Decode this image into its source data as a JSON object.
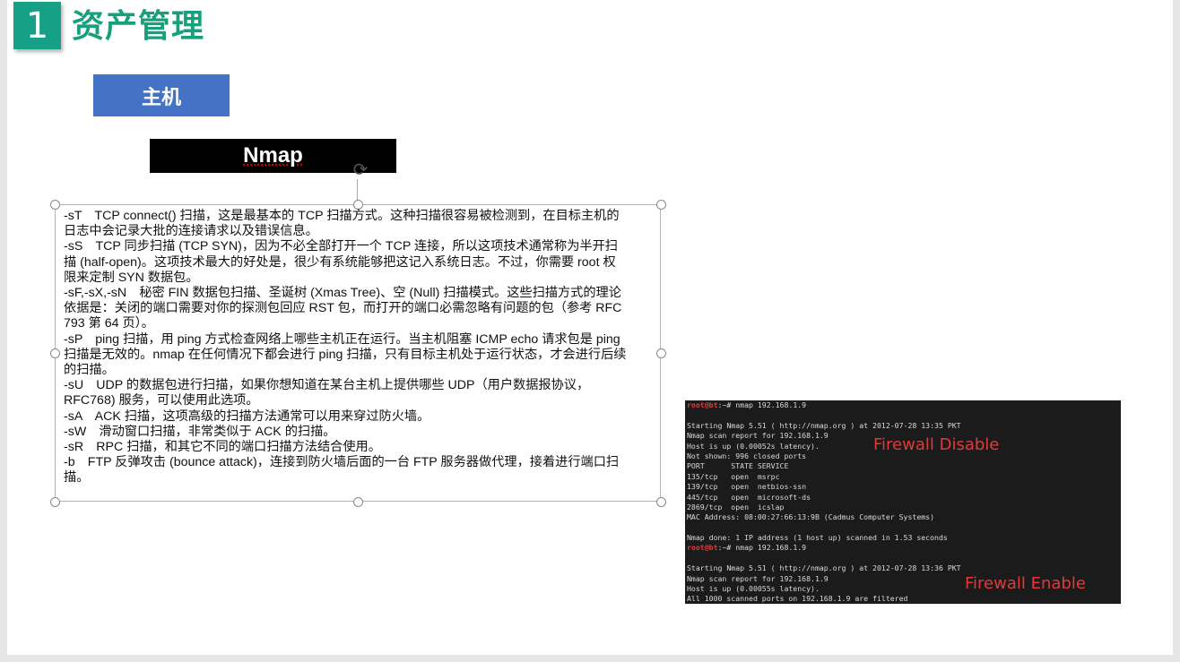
{
  "header": {
    "number": "1",
    "title": "资产管理"
  },
  "host_label": "主机",
  "nmap_label": "Nmap",
  "options": [
    {
      "flag": "-sT",
      "lines": [
        "-sT　TCP connect() 扫描，这是最基本的 TCP 扫描方式。这种扫描很容易被检测到，在目标主机的",
        "日志中会记录大批的连接请求以及错误信息。"
      ]
    },
    {
      "flag": "-sS",
      "lines": [
        " -sS　TCP 同步扫描 (TCP SYN)，因为不必全部打开一个 TCP 连接，所以这项技术通常称为半开扫",
        "描 (half-open)。这项技术最大的好处是，很少有系统能够把这记入系统日志。不过，你需要 root 权",
        "限来定制 SYN 数据包。"
      ]
    },
    {
      "flag": "-sF,-sX,-sN",
      "lines": [
        "-sF,-sX,-sN　秘密 FIN 数据包扫描、圣诞树 (Xmas Tree)、空 (Null) 扫描模式。这些扫描方式的理论",
        "依据是：关闭的端口需要对你的探测包回应 RST 包，而打开的端口必需忽略有问题的包（参考 RFC",
        "793 第 64 页）。"
      ]
    },
    {
      "flag": "-sP",
      "lines": [
        " -sP　ping 扫描，用 ping 方式检查网络上哪些主机正在运行。当主机阻塞 ICMP echo 请求包是 ping",
        "扫描是无效的。nmap 在任何情况下都会进行 ping 扫描，只有目标主机处于运行状态，才会进行后续",
        "的扫描。"
      ]
    },
    {
      "flag": "-sU",
      "lines": [
        "-sU　UDP 的数据包进行扫描，如果你想知道在某台主机上提供哪些 UDP（用户数据报协议，",
        "RFC768) 服务，可以使用此选项。"
      ]
    },
    {
      "flag": "-sA",
      "lines": [
        "-sA　ACK 扫描，这项高级的扫描方法通常可以用来穿过防火墙。"
      ]
    },
    {
      "flag": "-sW",
      "lines": [
        " -sW　滑动窗口扫描，非常类似于 ACK 的扫描。"
      ]
    },
    {
      "flag": "-sR",
      "lines": [
        " -sR　RPC 扫描，和其它不同的端口扫描方法结合使用。"
      ]
    },
    {
      "flag": "-b",
      "lines": [
        " -b　FTP 反弹攻击 (bounce attack)，连接到防火墙后面的一台 FTP 服务器做代理，接着进行端口扫",
        "描。"
      ]
    }
  ],
  "terminal": {
    "session1": [
      {
        "prompt": "root@bt",
        "text": ":~# nmap 192.168.1.9"
      },
      {
        "text": ""
      },
      {
        "text": "Starting Nmap 5.51 ( http://nmap.org ) at 2012-07-28 13:35 PKT"
      },
      {
        "text": "Nmap scan report for 192.168.1.9"
      },
      {
        "text": "Host is up (0.00052s latency)."
      },
      {
        "text": "Not shown: 996 closed ports"
      },
      {
        "text": "PORT      STATE SERVICE"
      },
      {
        "text": "135/tcp   open  msrpc"
      },
      {
        "text": "139/tcp   open  netbios-ssn"
      },
      {
        "text": "445/tcp   open  microsoft-ds"
      },
      {
        "text": "2869/tcp  open  icslap"
      },
      {
        "text": "MAC Address: 08:00:27:66:13:9B (Cadmus Computer Systems)"
      },
      {
        "text": ""
      },
      {
        "text": "Nmap done: 1 IP address (1 host up) scanned in 1.53 seconds"
      }
    ],
    "session2": [
      {
        "prompt": "root@bt",
        "text": ":~# nmap 192.168.1.9"
      },
      {
        "text": ""
      },
      {
        "text": "Starting Nmap 5.51 ( http://nmap.org ) at 2012-07-28 13:36 PKT"
      },
      {
        "text": "Nmap scan report for 192.168.1.9"
      },
      {
        "text": "Host is up (0.00055s latency)."
      },
      {
        "text": "All 1000 scanned ports on 192.168.1.9 are filtered"
      }
    ],
    "label_disable": "Firewall Disable",
    "label_enable": "Firewall Enable"
  },
  "colors": {
    "accent_green": "#17a07c",
    "host_blue": "#4472c4",
    "terminal_red": "#e03a3a"
  }
}
